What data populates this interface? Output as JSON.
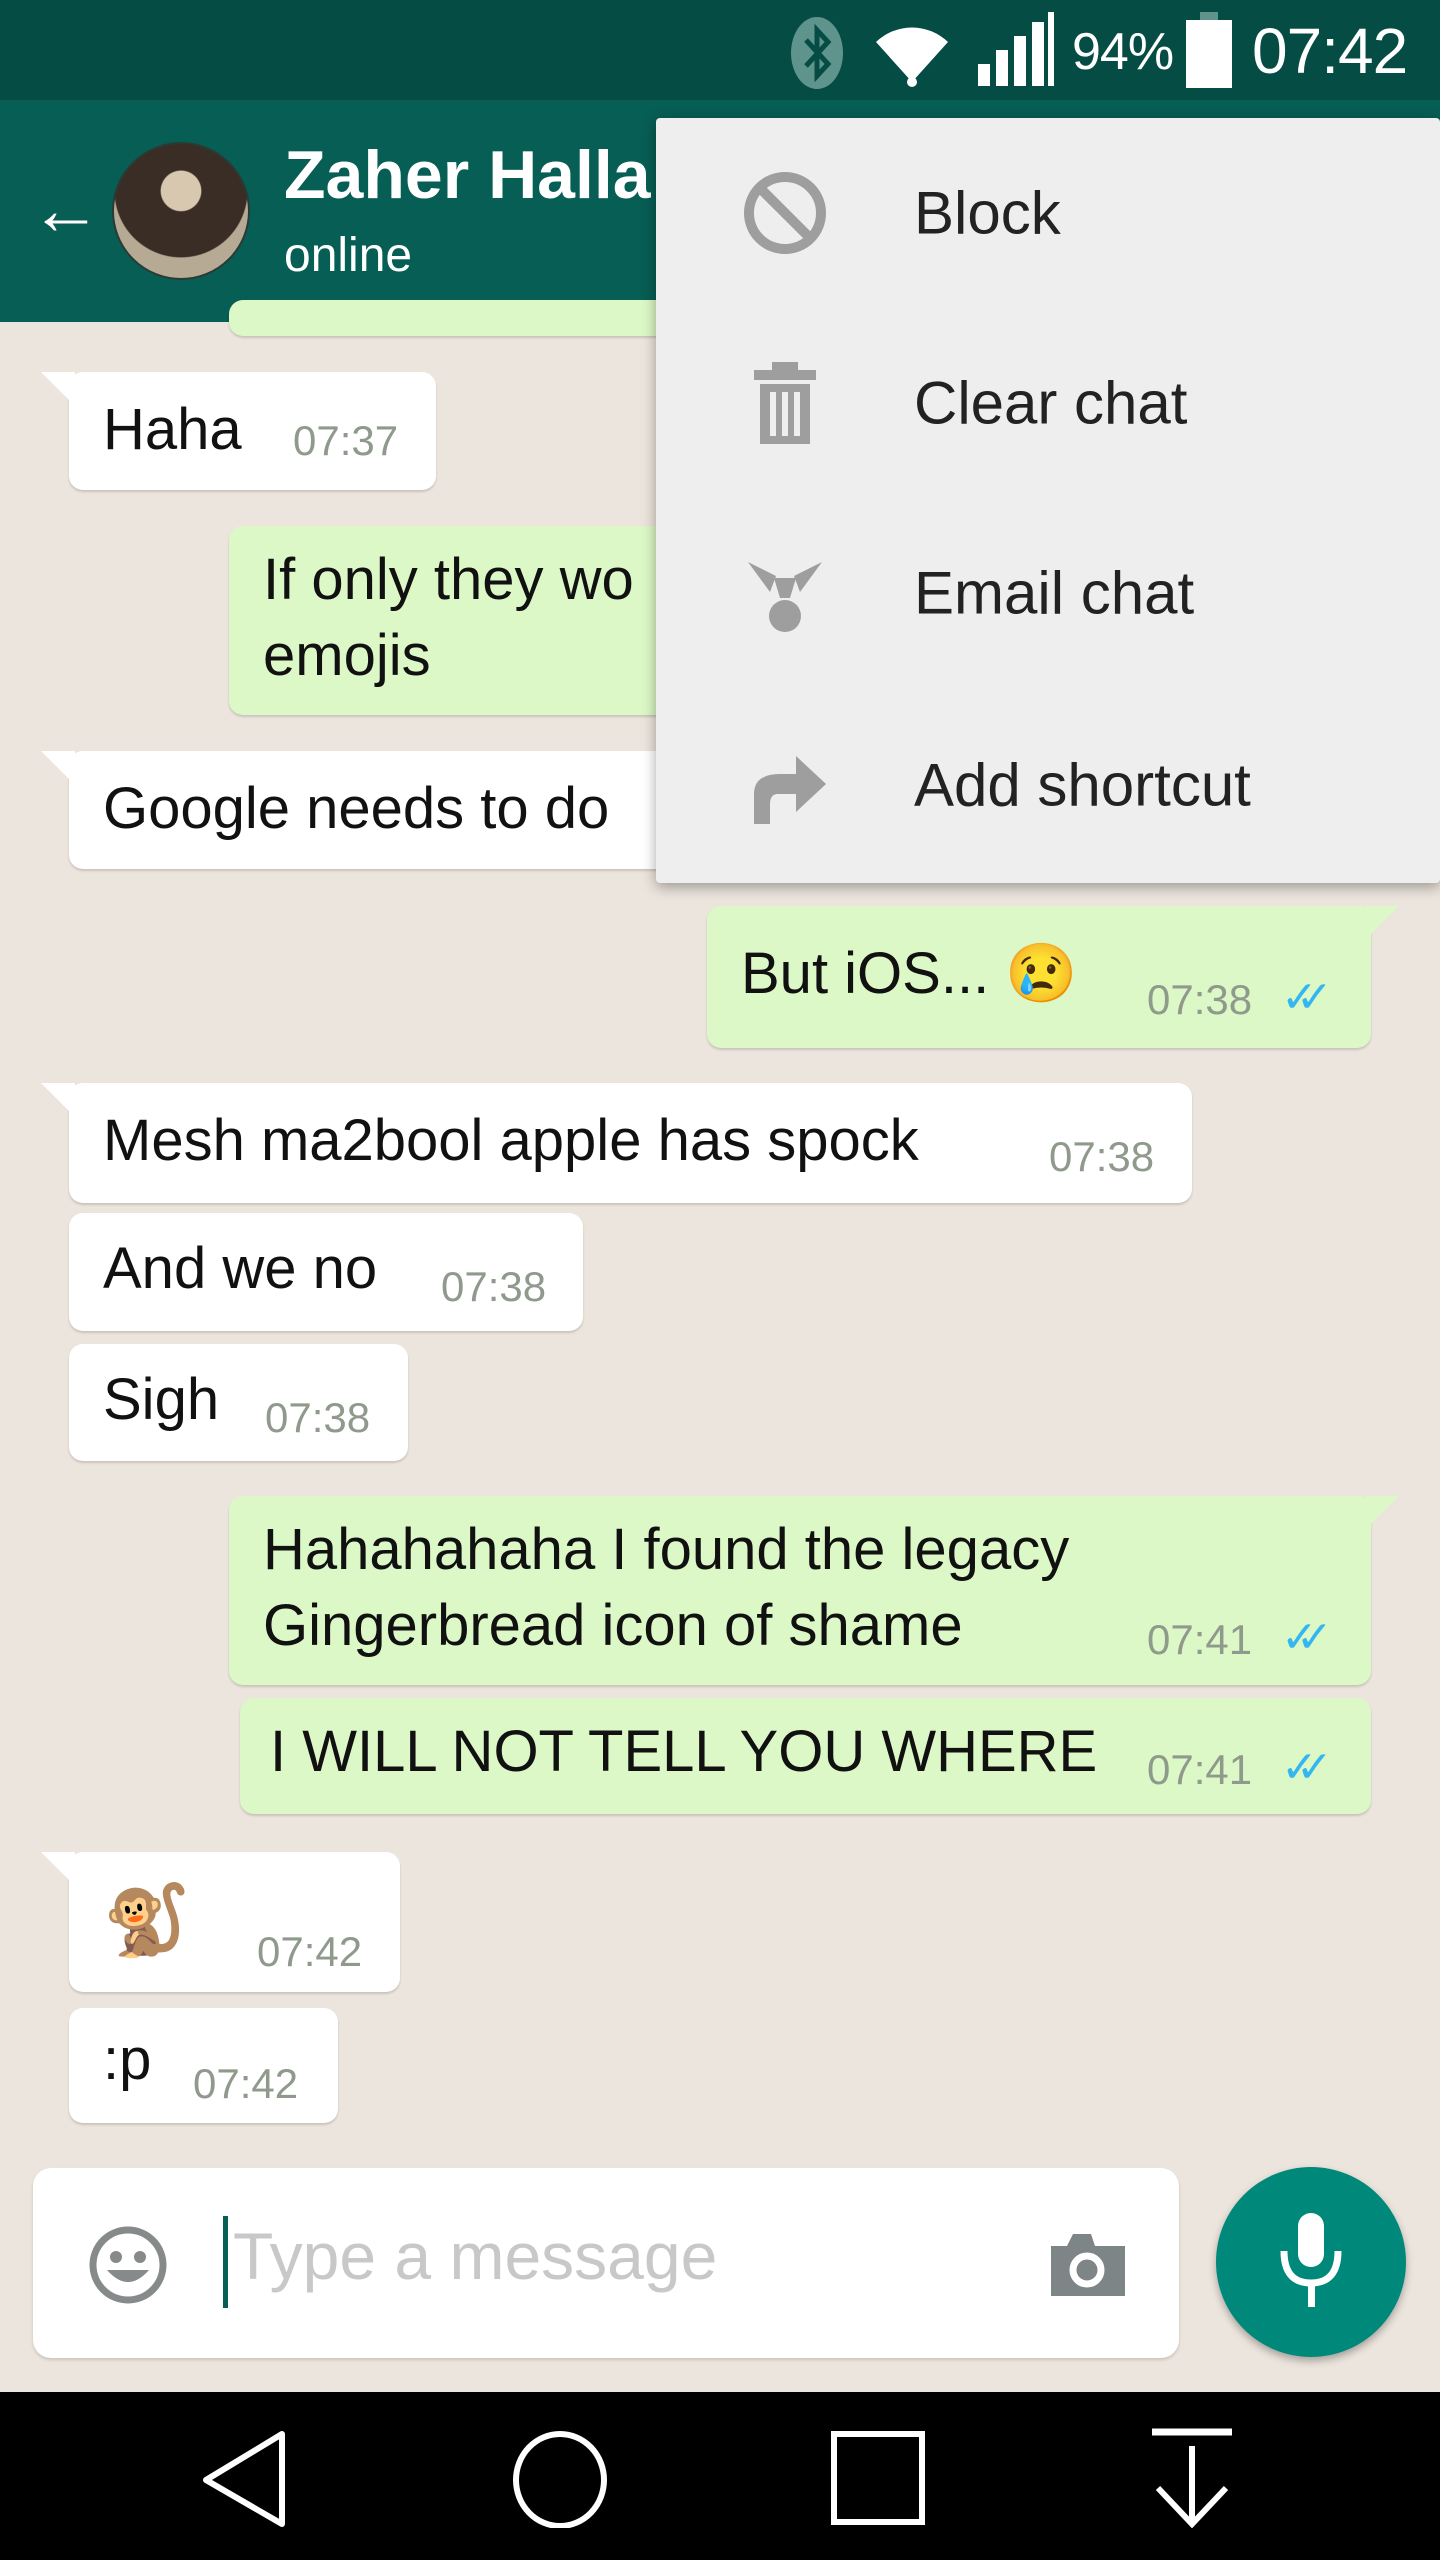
{
  "status_bar": {
    "battery_percent": "94%",
    "time": "07:42",
    "icons": [
      "bluetooth-icon",
      "wifi-icon",
      "signal-icon",
      "battery-icon"
    ]
  },
  "header": {
    "contact_name": "Zaher Halla",
    "status": "online"
  },
  "menu": {
    "items": [
      {
        "label": "Block",
        "icon": "block-icon"
      },
      {
        "label": "Clear chat",
        "icon": "trash-icon"
      },
      {
        "label": "Email chat",
        "icon": "email-chat-icon"
      },
      {
        "label": "Add shortcut",
        "icon": "shortcut-arrow-icon"
      }
    ]
  },
  "messages": [
    {
      "dir": "in",
      "text": "Haha",
      "time": "07:37"
    },
    {
      "dir": "out",
      "text": "If only they wo",
      "text2": "emojis"
    },
    {
      "dir": "in",
      "text": "Google needs to do"
    },
    {
      "dir": "out",
      "text": "But iOS... 😢",
      "time": "07:38",
      "ticks": "✓✓"
    },
    {
      "dir": "in",
      "text": "Mesh ma2bool apple has spock",
      "time": "07:38"
    },
    {
      "dir": "in",
      "text": "And we no",
      "time": "07:38"
    },
    {
      "dir": "in",
      "text": "Sigh",
      "time": "07:38"
    },
    {
      "dir": "out",
      "text": "Hahahahaha I found the legacy",
      "text2": "Gingerbread icon of shame",
      "time": "07:41",
      "ticks": "✓✓"
    },
    {
      "dir": "out",
      "text": "I WILL NOT TELL YOU WHERE",
      "time": "07:41",
      "ticks": "✓✓"
    },
    {
      "dir": "in",
      "text": "🐒",
      "time": "07:42"
    },
    {
      "dir": "in",
      "text": ":p",
      "time": "07:42"
    }
  ],
  "composer": {
    "placeholder": "Type a message"
  },
  "colors": {
    "header": "#075e54",
    "status_bar": "#054d44",
    "outgoing": "#dcf8c6",
    "accent": "#00897b",
    "ticks": "#34b7f1"
  }
}
